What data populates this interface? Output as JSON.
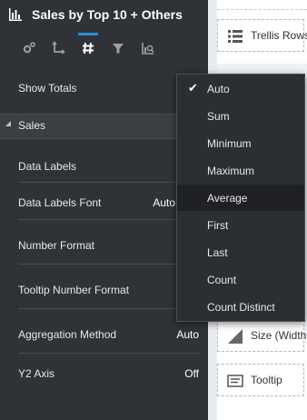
{
  "header": {
    "title": "Sales by Top 10 + Others",
    "icon": "bar-chart-icon"
  },
  "toolbar": {
    "tabs": [
      "general-icon",
      "axis-icon",
      "values-icon",
      "filter-icon",
      "analytics-icon"
    ],
    "active_index": 2,
    "accent": "#2b8fd6"
  },
  "rows": {
    "show_totals": {
      "label": "Show Totals"
    },
    "section_sales": {
      "label": "Sales"
    },
    "data_labels": {
      "label": "Data Labels"
    },
    "data_labels_font": {
      "label": "Data Labels Font",
      "value": "Auto"
    },
    "number_format": {
      "label": "Number Format"
    },
    "tooltip_number_format": {
      "label": "Tooltip Number Format"
    },
    "aggregation_method": {
      "label": "Aggregation Method",
      "value": "Auto"
    },
    "y2_axis": {
      "label": "Y2 Axis",
      "value": "Off"
    }
  },
  "right_panel": {
    "trellis_rows": "Trellis Rows",
    "size_width": "Size (Width",
    "tooltip": "Tooltip"
  },
  "menu": {
    "items": [
      "Auto",
      "Sum",
      "Minimum",
      "Maximum",
      "Average",
      "First",
      "Last",
      "Count",
      "Count Distinct"
    ],
    "checked": "Auto",
    "highlighted": "Average",
    "check_glyph": "✔"
  }
}
